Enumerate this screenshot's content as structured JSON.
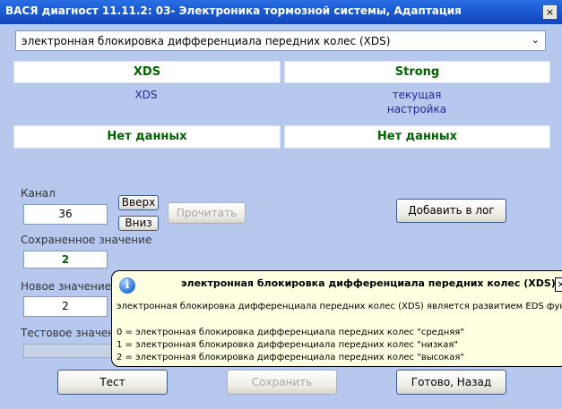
{
  "window": {
    "title": "ВАСЯ диагност 11.11.2: 03- Электроника тормозной системы, Адаптация",
    "close_glyph": "×"
  },
  "channel_select": {
    "value": "электронная блокировка дифференциала передних колес (XDS)",
    "arrow": "⌄"
  },
  "grid": {
    "col1_header": "XDS",
    "col2_header": "Strong",
    "col1_label": "XDS",
    "col2_label_line1": "текущая",
    "col2_label_line2": "настройка",
    "col1_value": "Нет данных",
    "col2_value": "Нет данных"
  },
  "channel": {
    "label": "Канал",
    "value": "36",
    "up_button": "Вверх",
    "down_button": "Вниз",
    "read_button": "Прочитать"
  },
  "saved": {
    "label": "Сохраненное значение",
    "value": "2"
  },
  "new_value": {
    "label": "Новое значение",
    "value": "2"
  },
  "test_value": {
    "label": "Тестовое значен"
  },
  "log_button": "Добавить в лог",
  "bottom_buttons": {
    "test": "Тест",
    "save": "Сохранить",
    "done": "Готово, Назад"
  },
  "tooltip": {
    "icon": "i",
    "title": "электронная блокировка дифференциала передних колес (XDS)",
    "close_glyph": "×",
    "description": "электронная блокировка дифференциала передних колес (XDS) является развитием EDS функц",
    "options": [
      "0 = электронная блокировка дифференциала передних колес \"средняя\"",
      "1 = электронная блокировка дифференциала передних колес \"низкая\"",
      "2 = электронная блокировка дифференциала передних колес \"высокая\""
    ]
  }
}
